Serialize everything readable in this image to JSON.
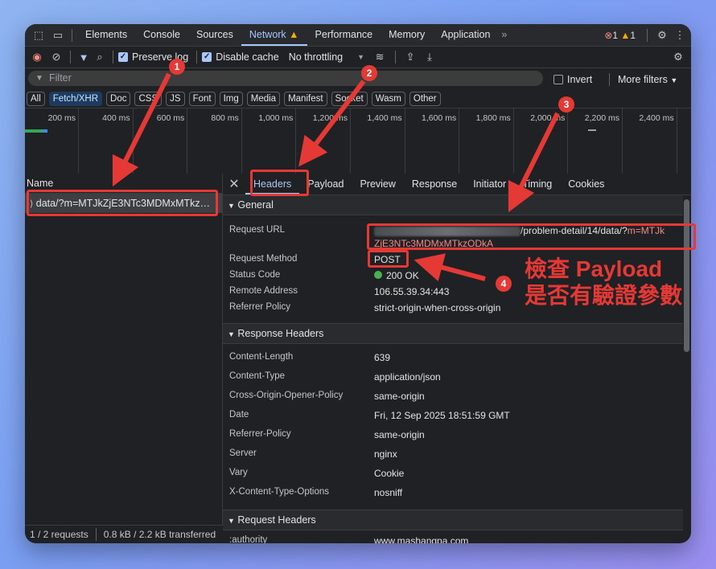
{
  "tabs": {
    "items": [
      "Elements",
      "Console",
      "Sources",
      "Network",
      "Performance",
      "Memory",
      "Application"
    ],
    "more": "»",
    "errors": "1",
    "warnings": "1"
  },
  "toolbar": {
    "preserve_log": "Preserve log",
    "disable_cache": "Disable cache",
    "throttling": "No throttling"
  },
  "filter": {
    "placeholder": "Filter",
    "invert": "Invert",
    "more_filters": "More filters"
  },
  "chips": [
    "All",
    "Fetch/XHR",
    "Doc",
    "CSS",
    "JS",
    "Font",
    "Img",
    "Media",
    "Manifest",
    "Socket",
    "Wasm",
    "Other"
  ],
  "timeline": {
    "ticks": [
      "200 ms",
      "400 ms",
      "600 ms",
      "800 ms",
      "1,000 ms",
      "1,200 ms",
      "1,400 ms",
      "1,600 ms",
      "1,800 ms",
      "2,000 ms",
      "2,200 ms",
      "2,400 ms"
    ]
  },
  "request_list": {
    "header": "Name",
    "item": "data/?m=MTJkZjE3NTc3MDMxMTkz…"
  },
  "statusbar": {
    "requests": "1 / 2 requests",
    "transferred": "0.8 kB / 2.2 kB transferred"
  },
  "detail_tabs": [
    "Headers",
    "Payload",
    "Preview",
    "Response",
    "Initiator",
    "Timing",
    "Cookies"
  ],
  "general": {
    "title": "General",
    "rows": [
      {
        "k": "Request URL",
        "v1": "/problem-detail/14/data/?",
        "v1b": "m=MTJk",
        "v2": "ZjE3NTc3MDMxMTkzODkA"
      },
      {
        "k": "Request Method",
        "v": "POST"
      },
      {
        "k": "Status Code",
        "v": "200 OK"
      },
      {
        "k": "Remote Address",
        "v": "106.55.39.34:443"
      },
      {
        "k": "Referrer Policy",
        "v": "strict-origin-when-cross-origin"
      }
    ]
  },
  "response_headers": {
    "title": "Response Headers",
    "rows": [
      {
        "k": "Content-Length",
        "v": "639"
      },
      {
        "k": "Content-Type",
        "v": "application/json"
      },
      {
        "k": "Cross-Origin-Opener-Policy",
        "v": "same-origin"
      },
      {
        "k": "Date",
        "v": "Fri, 12 Sep 2025 18:51:59 GMT"
      },
      {
        "k": "Referrer-Policy",
        "v": "same-origin"
      },
      {
        "k": "Server",
        "v": "nginx"
      },
      {
        "k": "Vary",
        "v": "Cookie"
      },
      {
        "k": "X-Content-Type-Options",
        "v": "nosniff"
      }
    ]
  },
  "request_headers": {
    "title": "Request Headers",
    "rows": [
      {
        "k": ":authority",
        "v": "www.mashangpa.com"
      }
    ]
  },
  "annotation": {
    "badges": [
      "1",
      "2",
      "3",
      "4"
    ],
    "line1": "檢查 Payload",
    "line2": "是否有驗證參數"
  },
  "colors": {
    "accent": "#a8c7fa",
    "annotation_red": "#e53935",
    "status_green": "#4caf50"
  }
}
